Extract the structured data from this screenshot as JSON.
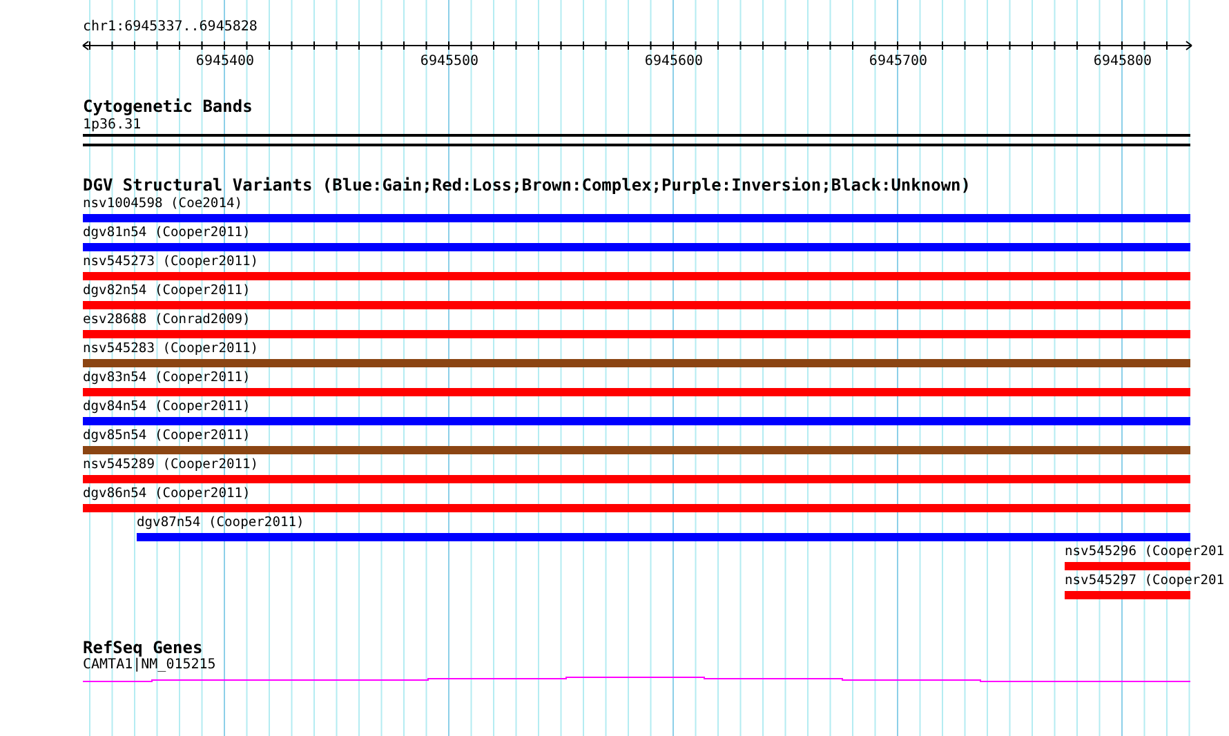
{
  "ruler": {
    "location": "chr1:6945337..6945828",
    "tick_labels": [
      "6945400",
      "6945500",
      "6945600",
      "6945700",
      "6945800"
    ]
  },
  "cytogenetic_bands": {
    "title": "Cytogenetic Bands",
    "band": "1p36.31"
  },
  "dgv": {
    "title": "DGV Structural Variants (Blue:Gain;Red:Loss;Brown:Complex;Purple:Inversion;Black:Unknown)",
    "features": [
      {
        "label": "nsv1004598 (Coe2014)",
        "color": "#0000ff",
        "kind": "spanning"
      },
      {
        "label": "dgv81n54 (Cooper2011)",
        "color": "#0000ff",
        "kind": "spanning"
      },
      {
        "label": "nsv545273 (Cooper2011)",
        "color": "#ff0000",
        "kind": "spanning"
      },
      {
        "label": "dgv82n54 (Cooper2011)",
        "color": "#ff0000",
        "kind": "spanning"
      },
      {
        "label": "esv28688 (Conrad2009)",
        "color": "#ff0000",
        "kind": "spanning"
      },
      {
        "label": "nsv545283 (Cooper2011)",
        "color": "#8b4513",
        "kind": "spanning"
      },
      {
        "label": "dgv83n54 (Cooper2011)",
        "color": "#ff0000",
        "kind": "spanning"
      },
      {
        "label": "dgv84n54 (Cooper2011)",
        "color": "#0000ff",
        "kind": "spanning"
      },
      {
        "label": "dgv85n54 (Cooper2011)",
        "color": "#8b4513",
        "kind": "spanning"
      },
      {
        "label": "nsv545289 (Cooper2011)",
        "color": "#ff0000",
        "kind": "spanning"
      },
      {
        "label": "dgv86n54 (Cooper2011)",
        "color": "#ff0000",
        "kind": "spanning"
      },
      {
        "label": "dgv87n54 (Cooper2011)",
        "color": "#0000ff",
        "kind": "early"
      },
      {
        "label": "nsv545296 (Cooper201",
        "color": "#ff0000",
        "kind": "late"
      },
      {
        "label": "nsv545297 (Cooper201",
        "color": "#ff0000",
        "kind": "late"
      }
    ]
  },
  "refseq_genes": {
    "title": "RefSeq Genes",
    "gene": "CAMTA1|NM_015215"
  }
}
